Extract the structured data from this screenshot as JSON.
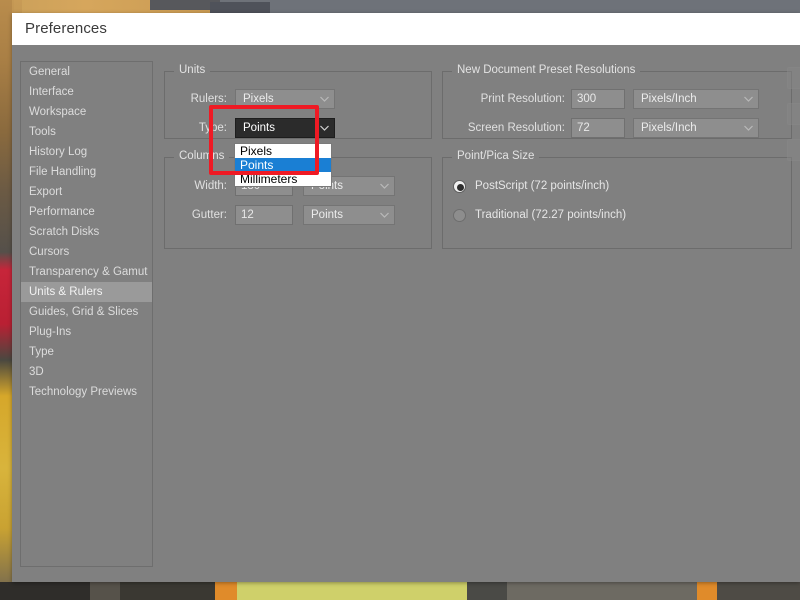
{
  "window": {
    "title": "Preferences"
  },
  "sidebar": {
    "items": [
      {
        "label": "General",
        "selected": false
      },
      {
        "label": "Interface",
        "selected": false
      },
      {
        "label": "Workspace",
        "selected": false
      },
      {
        "label": "Tools",
        "selected": false
      },
      {
        "label": "History Log",
        "selected": false
      },
      {
        "label": "File Handling",
        "selected": false
      },
      {
        "label": "Export",
        "selected": false
      },
      {
        "label": "Performance",
        "selected": false
      },
      {
        "label": "Scratch Disks",
        "selected": false
      },
      {
        "label": "Cursors",
        "selected": false
      },
      {
        "label": "Transparency & Gamut",
        "selected": false
      },
      {
        "label": "Units & Rulers",
        "selected": true
      },
      {
        "label": "Guides, Grid & Slices",
        "selected": false
      },
      {
        "label": "Plug-Ins",
        "selected": false
      },
      {
        "label": "Type",
        "selected": false
      },
      {
        "label": "3D",
        "selected": false
      },
      {
        "label": "Technology Previews",
        "selected": false
      }
    ]
  },
  "units_group": {
    "legend": "Units",
    "rulers": {
      "label": "Rulers:",
      "value": "Pixels",
      "options": [
        "Pixels",
        "Points",
        "Millimeters"
      ]
    },
    "type": {
      "label": "Type:",
      "value": "Points",
      "expanded": true,
      "options": [
        {
          "label": "Pixels",
          "selected": false
        },
        {
          "label": "Points",
          "selected": true
        },
        {
          "label": "Millimeters",
          "selected": false
        }
      ]
    }
  },
  "columns_group": {
    "legend": "Columns",
    "width": {
      "label": "Width:",
      "value": "180",
      "unit": "Points"
    },
    "gutter": {
      "label": "Gutter:",
      "value": "12",
      "unit": "Points"
    }
  },
  "resolutions_group": {
    "legend": "New Document Preset Resolutions",
    "print": {
      "label": "Print Resolution:",
      "value": "300",
      "unit": "Pixels/Inch"
    },
    "screen": {
      "label": "Screen Resolution:",
      "value": "72",
      "unit": "Pixels/Inch"
    }
  },
  "point_pica_group": {
    "legend": "Point/Pica Size",
    "options": [
      {
        "label": "PostScript (72 points/inch)",
        "selected": true
      },
      {
        "label": "Traditional (72.27 points/inch)",
        "selected": false
      }
    ]
  },
  "colors": {
    "dialog_bg": "#808080",
    "titlebar_bg": "#ffffff",
    "annotation_red": "#ef1a24",
    "dropdown_highlight": "#1a7fd4",
    "open_combo_bg": "#2b2b2b"
  }
}
